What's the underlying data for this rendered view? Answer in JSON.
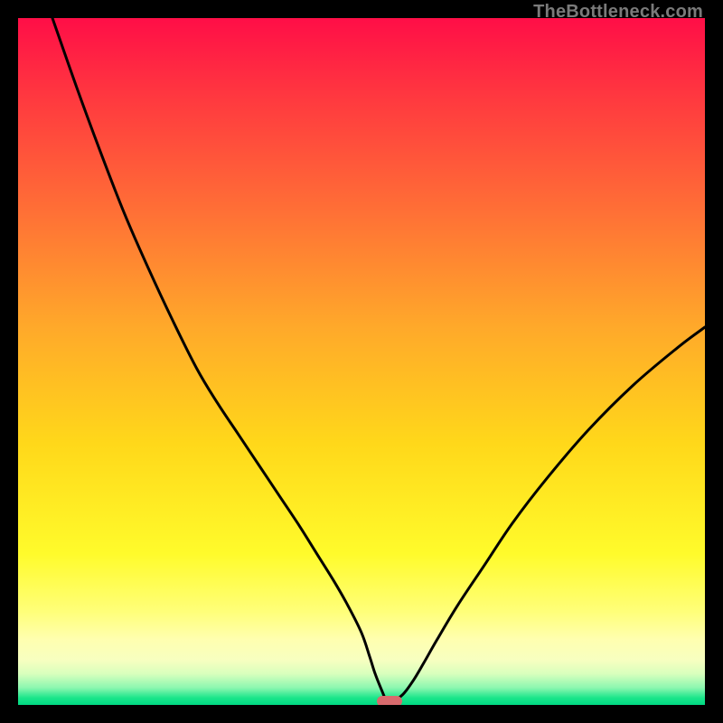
{
  "watermark": {
    "text": "TheBottleneck.com",
    "color": "#7a7a7a"
  },
  "chart_data": {
    "type": "line",
    "title": "",
    "xlabel": "",
    "ylabel": "",
    "x_range": [
      0,
      1
    ],
    "y_range": [
      0,
      100
    ],
    "background_gradient_stops": [
      {
        "offset": 0.0,
        "color": "#ff0e47"
      },
      {
        "offset": 0.12,
        "color": "#ff3a3f"
      },
      {
        "offset": 0.28,
        "color": "#ff6f36"
      },
      {
        "offset": 0.45,
        "color": "#ffa92a"
      },
      {
        "offset": 0.62,
        "color": "#ffd81a"
      },
      {
        "offset": 0.78,
        "color": "#fffb2b"
      },
      {
        "offset": 0.865,
        "color": "#ffff7a"
      },
      {
        "offset": 0.905,
        "color": "#ffffb0"
      },
      {
        "offset": 0.935,
        "color": "#f7ffc0"
      },
      {
        "offset": 0.955,
        "color": "#d8ffbd"
      },
      {
        "offset": 0.975,
        "color": "#8cf7b0"
      },
      {
        "offset": 0.99,
        "color": "#19e58a"
      },
      {
        "offset": 1.0,
        "color": "#00d983"
      }
    ],
    "series": [
      {
        "name": "bottleneck-curve",
        "color": "#000000",
        "stroke_width": 3,
        "x": [
          0.05,
          0.085,
          0.12,
          0.155,
          0.19,
          0.225,
          0.26,
          0.29,
          0.32,
          0.35,
          0.38,
          0.41,
          0.435,
          0.46,
          0.48,
          0.5,
          0.512,
          0.52,
          0.53,
          0.537,
          0.545,
          0.56,
          0.575,
          0.59,
          0.61,
          0.64,
          0.68,
          0.72,
          0.77,
          0.83,
          0.895,
          0.96,
          1.0
        ],
        "values": [
          100.0,
          90.0,
          80.5,
          71.5,
          63.5,
          56.0,
          49.0,
          44.0,
          39.5,
          35.0,
          30.5,
          26.0,
          22.0,
          18.0,
          14.5,
          10.5,
          7.0,
          4.5,
          2.0,
          0.5,
          0.5,
          1.5,
          3.5,
          6.0,
          9.5,
          14.5,
          20.5,
          26.5,
          33.0,
          40.0,
          46.5,
          52.0,
          55.0
        ]
      }
    ],
    "marker": {
      "x": 0.541,
      "y": 0.5,
      "color": "#d86a6d"
    }
  }
}
